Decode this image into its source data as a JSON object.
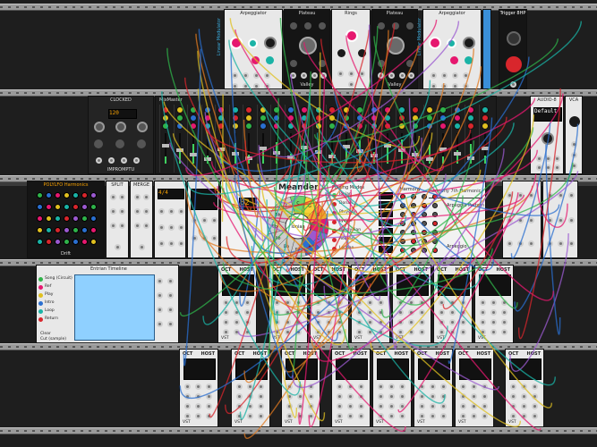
{
  "rack": {
    "row1": {
      "clouds_title": "Arpeggiator",
      "plaits_a_title": "Plateau",
      "plaits_a_bottom": "Valley",
      "ring_title": "Rings",
      "plaits_b_title": "Plateau",
      "plaits_b_bottom": "Valley",
      "clouds2_title": "Arpeggiator",
      "trigger_title": "Trigger 8HP",
      "side_label_a": "Linear Modulator",
      "side_label_b": "Linear Modulator"
    },
    "row2": {
      "clocked_title": "CLOCKED",
      "clocked_display": "120",
      "clocked_sub": "IMPROMPTU",
      "mixer_title": "MixMaster",
      "audio_title": "AUDIO-8",
      "audio_display": "Default",
      "vca_title": "VCA"
    },
    "row3": {
      "poly_title": "POLYLFO Harmonics",
      "poly_bottom": "Drift",
      "split_title": "SPLIT",
      "merge_title": "MERGE",
      "seq_display": "4/4",
      "meander_title": "Meander",
      "meander_logo": "Ionian",
      "meander_tabs": [
        "Playing Modes",
        "Harmony",
        "Melody",
        "Bass"
      ],
      "meander_keys": [
        "C",
        "G",
        "D",
        "A",
        "E",
        "B",
        "F#",
        "Db",
        "Ab",
        "Eb",
        "Bb",
        "F"
      ],
      "meander_rows": [
        "Ionian",
        "Dorian",
        "Phrygian",
        "Lydian",
        "Mixolydian",
        "Aeolian",
        "Locrian"
      ],
      "staff_label": "Harmony 7th Harmonic",
      "right_panel_label": "Arpeggio Pattern",
      "right_panel_sub": "Arpeggio",
      "disp_82": "82"
    },
    "row4": {
      "timeline_title": "Entrian Timeline",
      "timeline_items": [
        "Song (Circuit)",
        "Ref",
        "Play",
        "Intro",
        "Loop",
        "Return"
      ],
      "timeline_btn_a": "Clear",
      "timeline_btn_b": "Cut (sample)"
    },
    "host_modules": {
      "label_oct": "OCT",
      "label_host": "HOST",
      "label_vst": "VST",
      "side_label": "VCV Host"
    }
  },
  "colors": {
    "panel_light": "#e8e8e8",
    "panel_dark": "#242424",
    "accent_pink": "#e6186f",
    "accent_teal": "#1ab3a6",
    "accent_blue": "#2a7ed8",
    "screen_orange": "#f7a100",
    "cable_red": "#d8262c",
    "cable_green": "#2fb34a",
    "cable_yellow": "#e0c020",
    "cable_blue": "#2a6fd0"
  }
}
